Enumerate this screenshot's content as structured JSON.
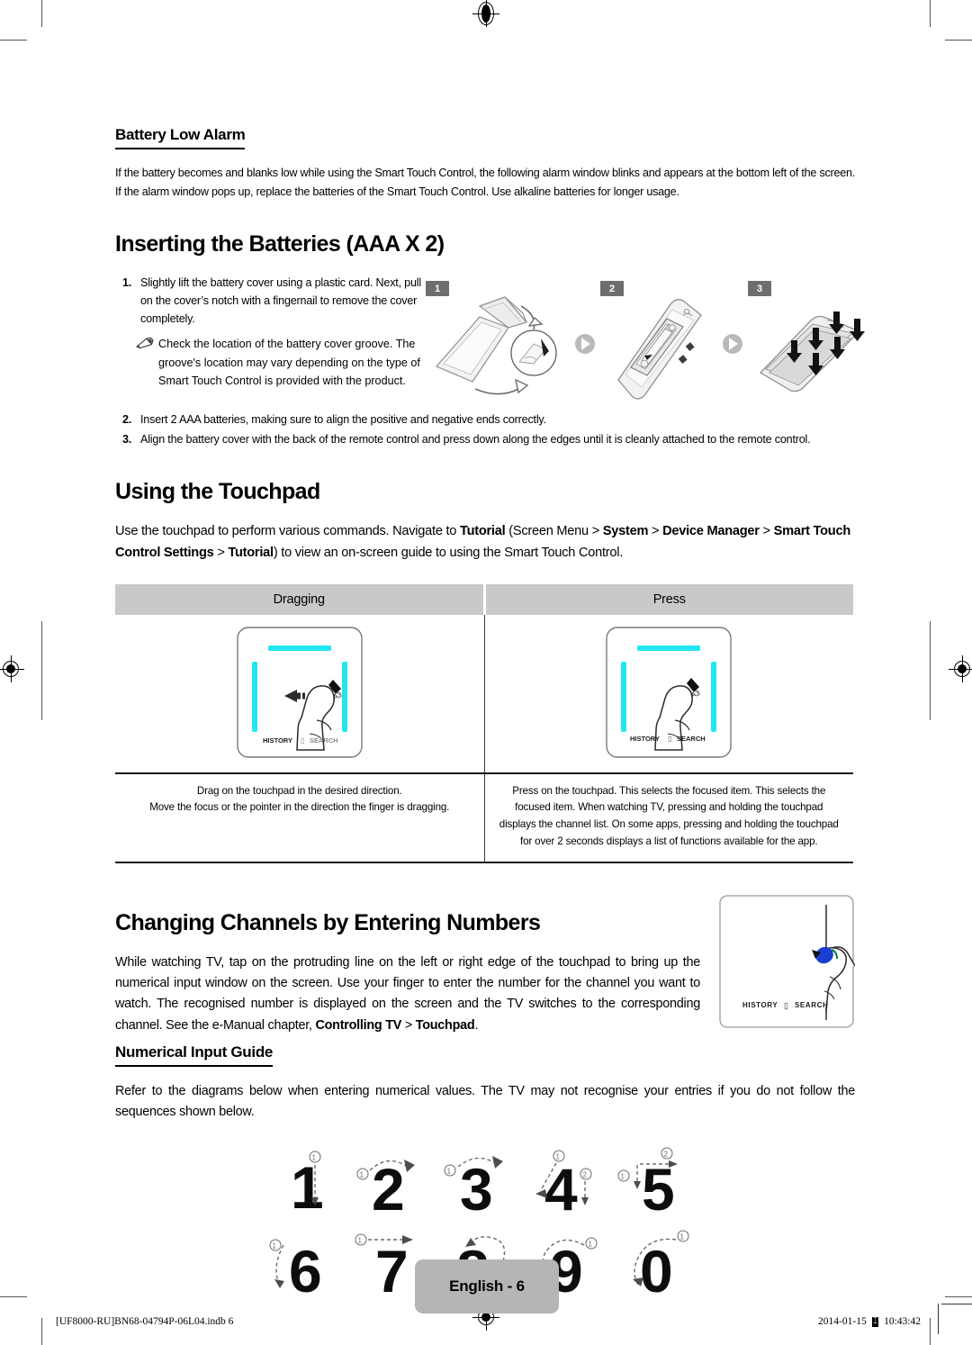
{
  "document": {
    "page_label": "English - 6",
    "footer_left": "[UF8000-RU]BN68-04794P-06L04.indb   6",
    "footer_date": "2014-01-15",
    "footer_time": "10:43:42",
    "footer_glyph": "⌶"
  },
  "battery_low_alarm": {
    "heading": "Battery Low Alarm",
    "body": "If the battery becomes and blanks low while using the Smart Touch Control, the following alarm window blinks and appears at the bottom left of the screen. If the alarm window pops up, replace the batteries of the Smart Touch Control. Use alkaline batteries for longer usage."
  },
  "inserting_batteries": {
    "heading": "Inserting the Batteries (AAA X 2)",
    "steps": [
      {
        "num": "1.",
        "text": "Slightly lift the battery cover using a plastic card. Next, pull on the cover’s notch with a fingernail to remove the cover completely."
      },
      {
        "num": "2.",
        "text": "Insert 2 AAA batteries, making sure to align the positive and negative ends correctly."
      },
      {
        "num": "3.",
        "text": "Align the battery cover with the back of the remote control and press down along the edges until it is cleanly attached to the remote control."
      }
    ],
    "note": "Check the location of the battery cover groove. The groove's location may vary depending on the type of Smart Touch Control is provided with the product.",
    "figure_badges": [
      "1",
      "2",
      "3"
    ]
  },
  "using_touchpad": {
    "heading": "Using the Touchpad",
    "intro": {
      "p1": "Use the touchpad to perform various commands. Navigate to ",
      "b1": "Tutorial",
      "p2": " (Screen Menu > ",
      "b2": "System",
      "p3": " > ",
      "b3": "Device Manager",
      "p4": " > ",
      "b4": "Smart Touch Control Settings",
      "p5": " > ",
      "b5": "Tutorial",
      "p6": ") to view an on-screen guide to using the Smart Touch Control."
    },
    "table": {
      "headers": [
        "Dragging",
        "Press"
      ],
      "descriptions": [
        "Drag on the touchpad in the desired direction.\nMove the focus or the pointer in the direction the finger is dragging.",
        "Press on the touchpad. This selects the focused item. This selects the focused item. When watching TV, pressing and holding the touchpad displays the channel list. On some apps, pressing and holding the touchpad for over 2 seconds displays a list of functions available for the app."
      ],
      "pad_labels": {
        "history": "HISTORY",
        "search": "SEARCH",
        "glyph": "▯"
      }
    }
  },
  "changing_channels": {
    "heading": "Changing Channels by Entering Numbers",
    "body": {
      "p1": "While watching TV, tap on the protruding line on the left or right edge of the touchpad to bring up the numerical input window on the screen. Use your finger to enter the number for the channel you want to watch. The recognised number is displayed on the screen and the TV switches to the corresponding channel. See the e-Manual chapter, ",
      "b1": "Controlling TV",
      "p2": " > ",
      "b2": "Touchpad",
      "p3": "."
    },
    "pad_labels": {
      "history": "HISTORY",
      "search": "SEARCH",
      "glyph": "▯"
    }
  },
  "numerical_input_guide": {
    "heading": "Numerical Input Guide",
    "body": "Refer to the diagrams below when entering numerical values. The TV may not recognise your entries if you do not follow the sequences shown below.",
    "digits_row1": [
      "1",
      "2",
      "3",
      "4",
      "5"
    ],
    "digits_row2": [
      "6",
      "7",
      "8",
      "9",
      "0"
    ],
    "stroke_markers": {
      "one": "①",
      "two": "②"
    }
  },
  "colors": {
    "badge_gray": "#6d6e70",
    "table_header_gray": "#c9c9c9",
    "page_badge_gray": "#b5b5b5",
    "touchpad_cyan": "#21e6f0",
    "fingernail_blue": "#1a3fd0"
  }
}
